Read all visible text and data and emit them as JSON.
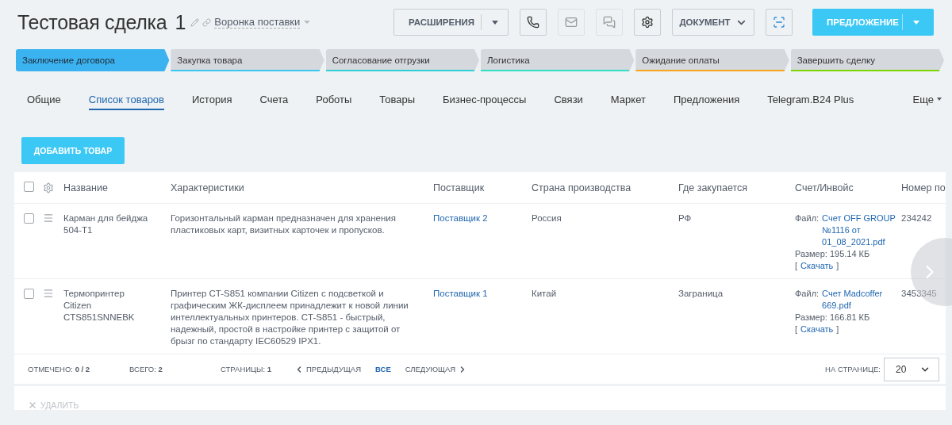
{
  "header": {
    "title": "Тестовая сделка",
    "number": "1",
    "pipeline": "Воронка поставки",
    "buttons": [
      {
        "kind": "split",
        "label": "РАСШИРЕНИЯ"
      },
      {
        "kind": "icon",
        "disabled": false
      },
      {
        "kind": "icon",
        "disabled": true
      },
      {
        "kind": "icon",
        "disabled": true
      },
      {
        "kind": "icon",
        "disabled": false
      },
      {
        "kind": "dropdown",
        "label": "ДОКУМЕНТ"
      },
      {
        "kind": "icon",
        "disabled": false
      },
      {
        "kind": "primary",
        "label": "ПРЕДЛОЖЕНИЕ"
      }
    ]
  },
  "stages": [
    {
      "label": "Заключение договора",
      "selected": true,
      "color": "#3bb3f0"
    },
    {
      "label": "Закупка товара",
      "selected": false,
      "color": "#39c8f2"
    },
    {
      "label": "Согласование отгрузки",
      "selected": false,
      "color": "#2fcfd8"
    },
    {
      "label": "Логистика",
      "selected": false,
      "color": "#2fe0c6"
    },
    {
      "label": "Ожидание оплаты",
      "selected": false,
      "color": "#f7a51b"
    },
    {
      "label": "Завершить сделку",
      "selected": false,
      "color": "#7bd500"
    }
  ],
  "tabs": [
    {
      "label": "Общие",
      "selected": false
    },
    {
      "label": "Список товаров",
      "selected": true
    },
    {
      "label": "История",
      "selected": false
    },
    {
      "label": "Счета",
      "selected": false
    },
    {
      "label": "Роботы",
      "selected": false
    },
    {
      "label": "Товары",
      "selected": false
    },
    {
      "label": "Бизнес-процессы",
      "selected": false
    },
    {
      "label": "Связи",
      "selected": false
    },
    {
      "label": "Маркет",
      "selected": false
    },
    {
      "label": "Предложения",
      "selected": false
    },
    {
      "label": "Telegram.B24 Plus",
      "selected": false
    }
  ],
  "more_tab": "Еще",
  "add_button": "ДОБАВИТЬ ТОВАР",
  "table": {
    "select_all_checked": false,
    "columns": [
      "Название",
      "Характеристики",
      "Поставщик",
      "Страна производства",
      "Где закупается",
      "Счет/Инвойс",
      "Номер по"
    ],
    "rows": [
      {
        "checked": false,
        "name": "Карман для бейджа 504-Т1",
        "description": "Горизонтальный карман предназначен для хранения пластиковых карт, визитных карточек и пропусков.",
        "supplier": "Поставщик 2",
        "country": "Россия",
        "where": "РФ",
        "invoice": {
          "file_label": "Файл:",
          "file_name": "Счет OFF GROUP №1116 от 01_08_2021.pdf",
          "size": "Размер: 195.14 КБ",
          "open": "[",
          "download": "Скачать",
          "close": "]"
        },
        "number": "234242"
      },
      {
        "checked": false,
        "name": "Термопринтер Citizen CTS851SNNEBK",
        "description": "Принтер CT-S851 компании Citizen с подсветкой и графическим ЖК-дисплеем принадлежит к новой линии интеллектуальных принтеров. CT-S851 - быстрый, надежный, простой в настройке принтер с защитой от брызг по стандарту IEC60529 IPX1.",
        "supplier": "Поставщик 1",
        "country": "Китай",
        "where": "Заграница",
        "invoice": {
          "file_label": "Файл:",
          "file_name": "Счет Madcoffer 669.pdf",
          "size": "Размер: 166.81 КБ",
          "open": "[",
          "download": "Скачать",
          "close": "]"
        },
        "number": "3453345"
      }
    ]
  },
  "footer": {
    "checked": "ОТМЕЧЕНО: **0 / 2**",
    "total": "ВСЕГО: **2**",
    "pages": "СТРАНИЦЫ:  **1**",
    "prev": "ПРЕДЫДУЩАЯ",
    "all": "ВСЕ",
    "next": "СЛЕДУЮЩАЯ",
    "per_page_label": "НА СТРАНИЦЕ:",
    "per_page": "20"
  },
  "delete_button": {
    "label": "УДАЛИТЬ",
    "disabled": true
  }
}
